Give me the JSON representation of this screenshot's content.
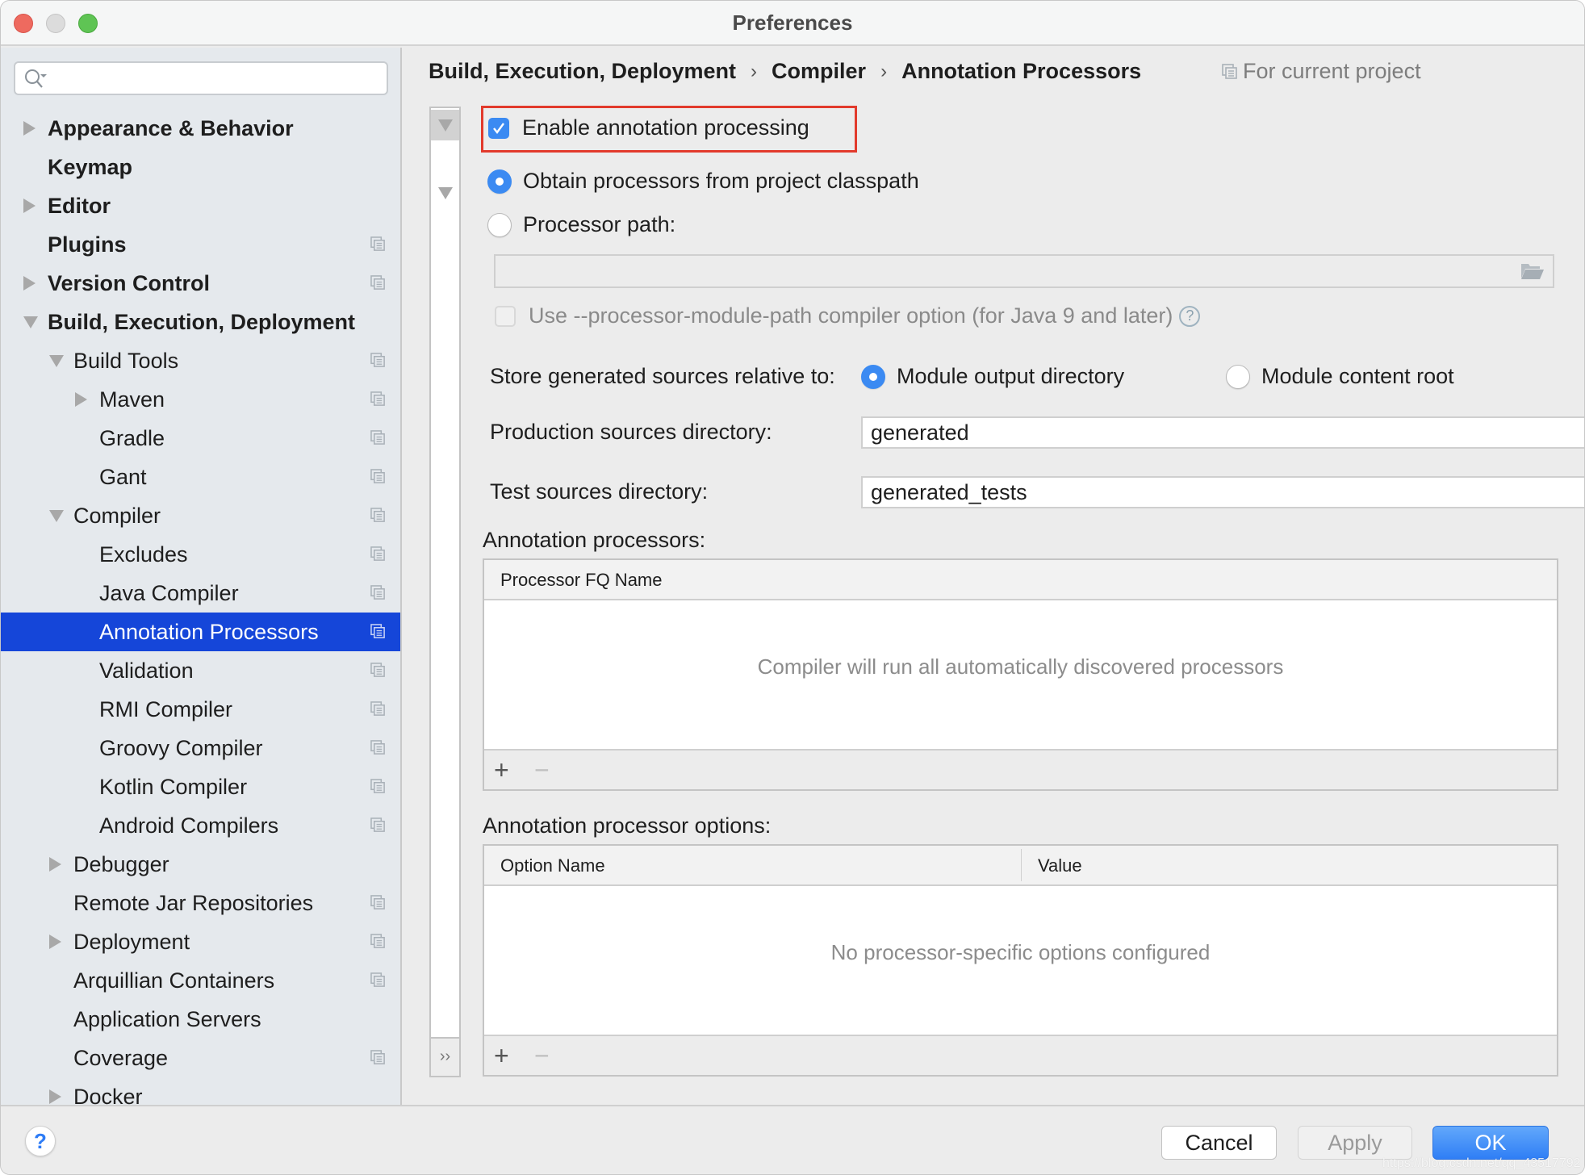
{
  "window": {
    "title": "Preferences"
  },
  "sidebar": {
    "search": {
      "placeholder": "",
      "value": ""
    },
    "items": [
      {
        "label": "Appearance & Behavior",
        "level": 0,
        "bold": true,
        "arrow": "right",
        "project_icon": false
      },
      {
        "label": "Keymap",
        "level": 0,
        "bold": true,
        "arrow": "none",
        "project_icon": false
      },
      {
        "label": "Editor",
        "level": 0,
        "bold": true,
        "arrow": "right",
        "project_icon": false
      },
      {
        "label": "Plugins",
        "level": 0,
        "bold": true,
        "arrow": "none",
        "project_icon": true
      },
      {
        "label": "Version Control",
        "level": 0,
        "bold": true,
        "arrow": "right",
        "project_icon": true
      },
      {
        "label": "Build, Execution, Deployment",
        "level": 0,
        "bold": true,
        "arrow": "down",
        "project_icon": false
      },
      {
        "label": "Build Tools",
        "level": 1,
        "bold": false,
        "arrow": "down",
        "project_icon": true
      },
      {
        "label": "Maven",
        "level": 2,
        "bold": false,
        "arrow": "right",
        "project_icon": true
      },
      {
        "label": "Gradle",
        "level": 2,
        "bold": false,
        "arrow": "none",
        "project_icon": true
      },
      {
        "label": "Gant",
        "level": 2,
        "bold": false,
        "arrow": "none",
        "project_icon": true
      },
      {
        "label": "Compiler",
        "level": 1,
        "bold": false,
        "arrow": "down",
        "project_icon": true
      },
      {
        "label": "Excludes",
        "level": 2,
        "bold": false,
        "arrow": "none",
        "project_icon": true
      },
      {
        "label": "Java Compiler",
        "level": 2,
        "bold": false,
        "arrow": "none",
        "project_icon": true
      },
      {
        "label": "Annotation Processors",
        "level": 2,
        "bold": false,
        "arrow": "none",
        "project_icon": true,
        "selected": true
      },
      {
        "label": "Validation",
        "level": 2,
        "bold": false,
        "arrow": "none",
        "project_icon": true
      },
      {
        "label": "RMI Compiler",
        "level": 2,
        "bold": false,
        "arrow": "none",
        "project_icon": true
      },
      {
        "label": "Groovy Compiler",
        "level": 2,
        "bold": false,
        "arrow": "none",
        "project_icon": true
      },
      {
        "label": "Kotlin Compiler",
        "level": 2,
        "bold": false,
        "arrow": "none",
        "project_icon": true
      },
      {
        "label": "Android Compilers",
        "level": 2,
        "bold": false,
        "arrow": "none",
        "project_icon": true
      },
      {
        "label": "Debugger",
        "level": 1,
        "bold": false,
        "arrow": "right",
        "project_icon": false
      },
      {
        "label": "Remote Jar Repositories",
        "level": 1,
        "bold": false,
        "arrow": "none",
        "project_icon": true
      },
      {
        "label": "Deployment",
        "level": 1,
        "bold": false,
        "arrow": "right",
        "project_icon": true
      },
      {
        "label": "Arquillian Containers",
        "level": 1,
        "bold": false,
        "arrow": "none",
        "project_icon": true
      },
      {
        "label": "Application Servers",
        "level": 1,
        "bold": false,
        "arrow": "none",
        "project_icon": false
      },
      {
        "label": "Coverage",
        "level": 1,
        "bold": false,
        "arrow": "none",
        "project_icon": true
      },
      {
        "label": "Docker",
        "level": 1,
        "bold": false,
        "arrow": "right",
        "project_icon": false
      }
    ]
  },
  "breadcrumb": {
    "items": [
      "Build, Execution, Deployment",
      "Compiler",
      "Annotation Processors"
    ],
    "separator": "›",
    "scope_label": "For current project"
  },
  "strip": {
    "expand_label": "››"
  },
  "settings": {
    "enable_annotation_processing": {
      "label": "Enable annotation processing",
      "checked": true
    },
    "processor_source": {
      "options": [
        {
          "label": "Obtain processors from project classpath",
          "selected": true
        },
        {
          "label": "Processor path:",
          "selected": false
        }
      ],
      "processor_path_value": ""
    },
    "module_path_option": {
      "label": "Use --processor-module-path compiler option (for Java 9 and later)",
      "checked": false,
      "enabled": false,
      "help": "?"
    },
    "store_generated": {
      "label": "Store generated sources relative to:",
      "options": [
        {
          "label": "Module output directory",
          "selected": true
        },
        {
          "label": "Module content root",
          "selected": false
        }
      ]
    },
    "production_sources": {
      "label": "Production sources directory:",
      "value": "generated"
    },
    "test_sources": {
      "label": "Test sources directory:",
      "value": "generated_tests"
    }
  },
  "processors_table": {
    "label": "Annotation processors:",
    "columns": [
      "Processor FQ Name"
    ],
    "rows": [],
    "empty_text": "Compiler will run all automatically discovered processors",
    "add_label": "+",
    "remove_label": "−"
  },
  "options_table": {
    "label": "Annotation processor options:",
    "columns": [
      "Option Name",
      "Value"
    ],
    "rows": [],
    "empty_text": "No processor-specific options configured",
    "add_label": "+",
    "remove_label": "−"
  },
  "footer": {
    "help_label": "?",
    "cancel_label": "Cancel",
    "apply_label": "Apply",
    "ok_label": "OK"
  },
  "watermark": "https://blog.csdn.net/qq_43517792",
  "colors": {
    "accent": "#3b8af2",
    "selection": "#1546d9",
    "highlight_box": "#e23a2c",
    "ok_button": "#2f7ef5"
  }
}
